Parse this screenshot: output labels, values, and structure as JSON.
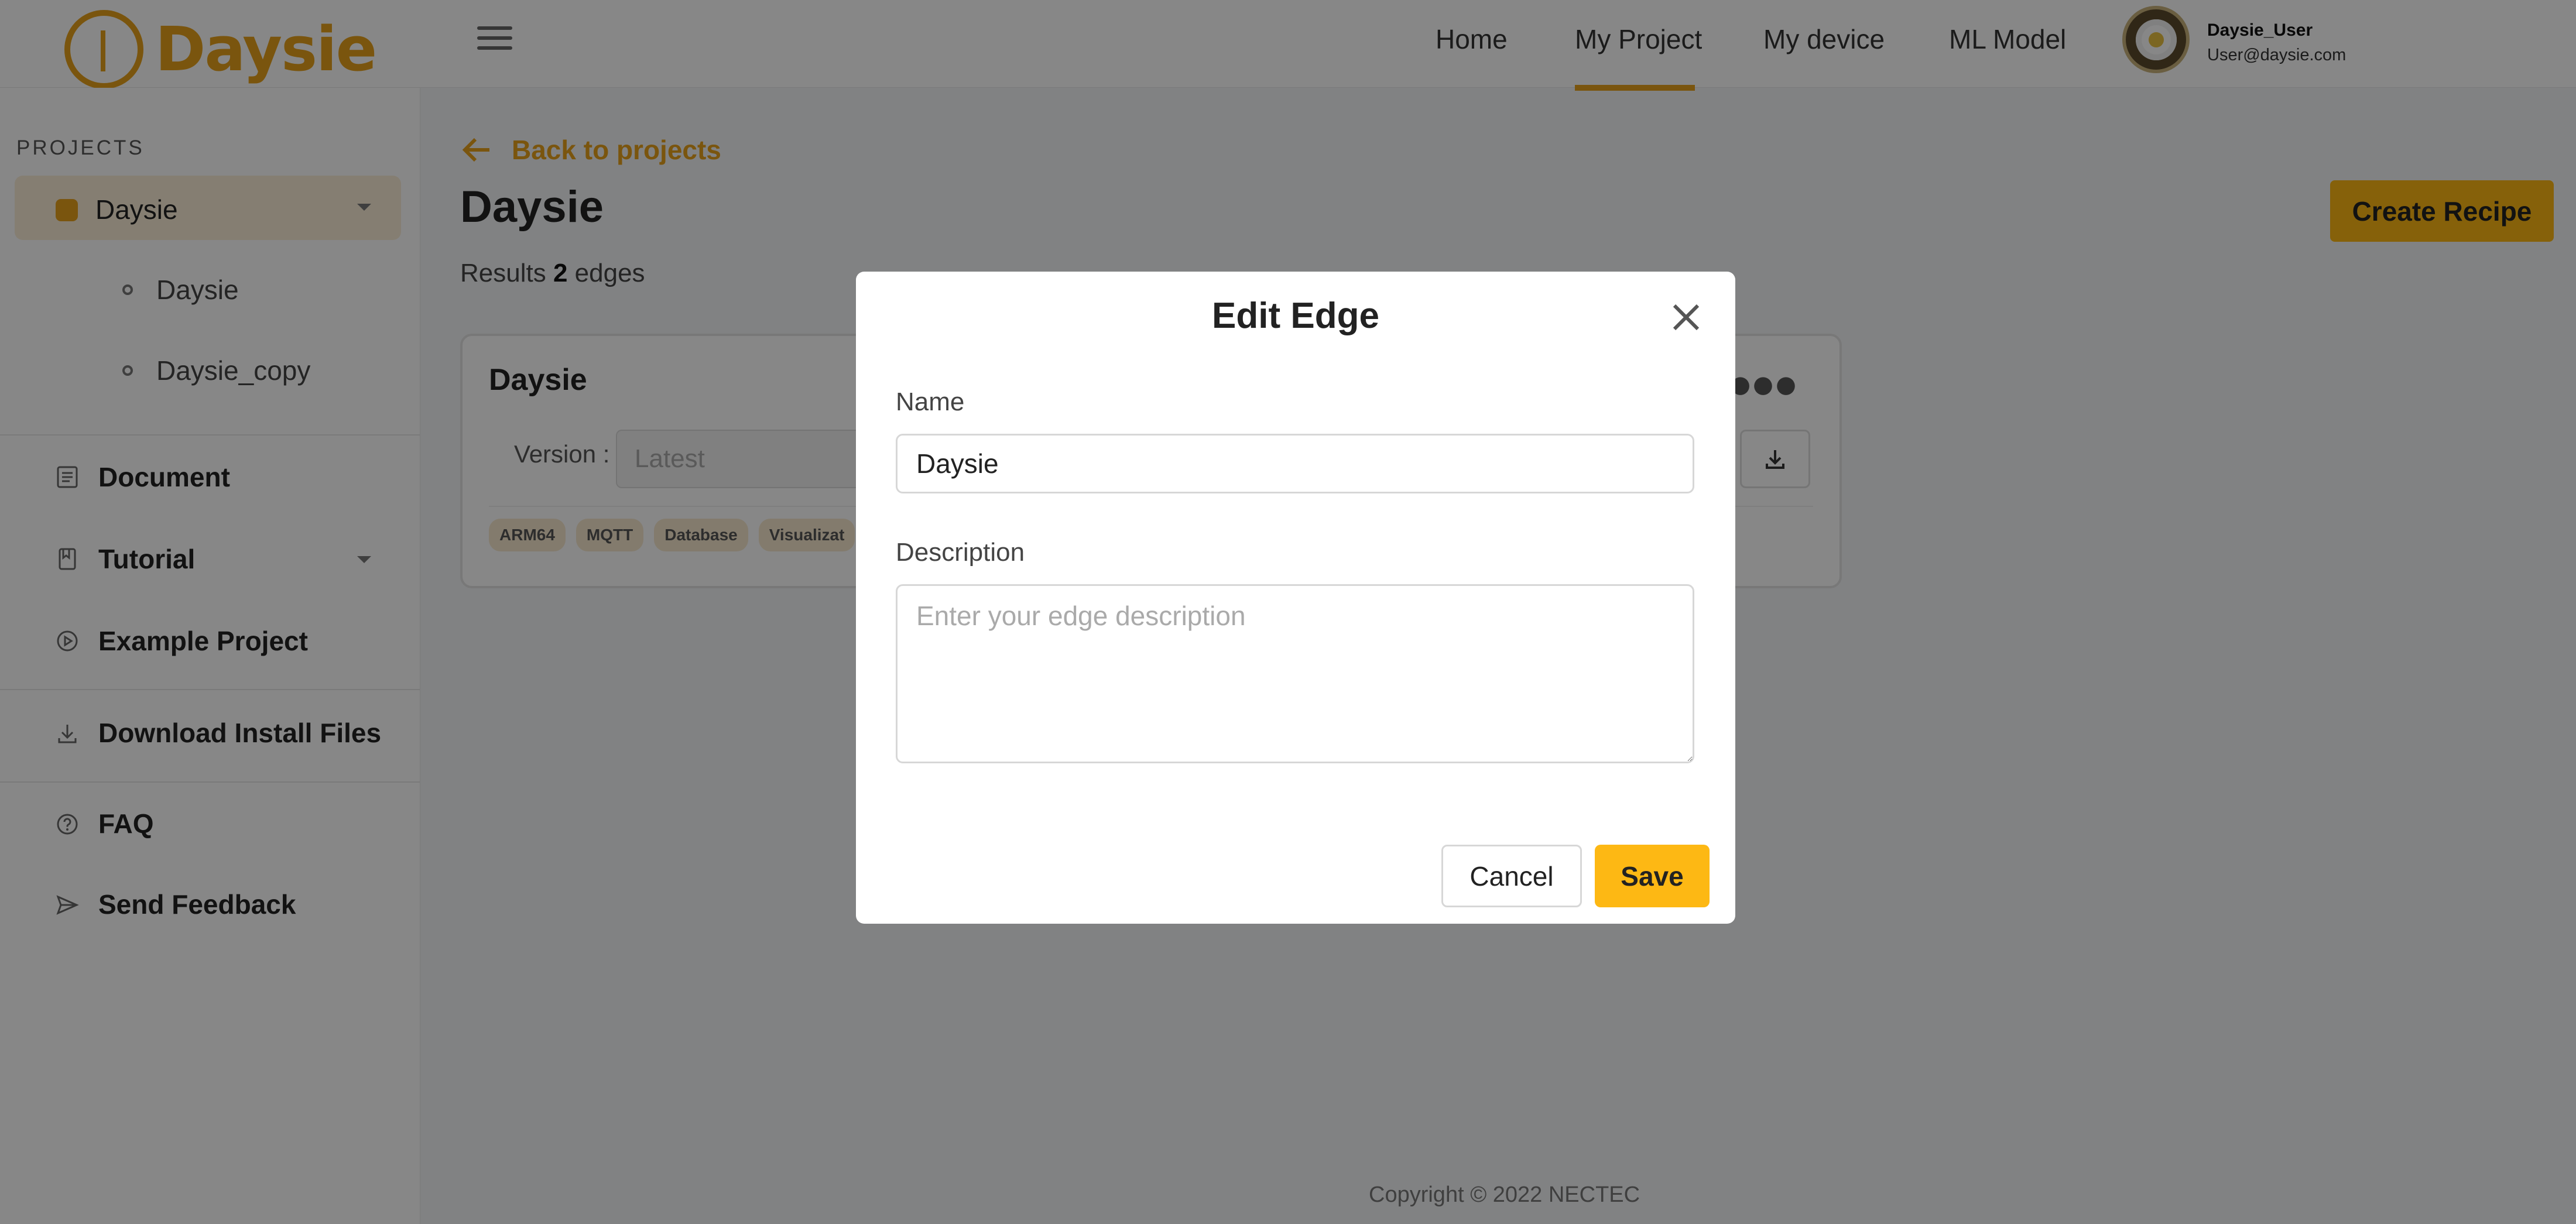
{
  "brand": {
    "name": "Daysie",
    "accent": "#e6a11c",
    "button": "#fdb814"
  },
  "nav": {
    "items": [
      "Home",
      "My Project",
      "My device",
      "ML Model"
    ],
    "active": "My Project"
  },
  "user": {
    "name": "Daysie_User",
    "email": "User@daysie.com"
  },
  "sidebar": {
    "heading": "PROJECTS",
    "project": "Daysie",
    "sub_items": [
      "Daysie",
      "Daysie_copy"
    ],
    "items": {
      "document": "Document",
      "tutorial": "Tutorial",
      "example": "Example Project",
      "download": "Download Install Files",
      "faq": "FAQ",
      "feedback": "Send Feedback"
    }
  },
  "main": {
    "back_label": "Back to projects",
    "title": "Daysie",
    "results_prefix": "Results",
    "results_count": "2",
    "results_suffix": "edges",
    "create_button": "Create Recipe",
    "card": {
      "name": "Daysie",
      "version_label": "Version :",
      "version_placeholder": "Latest",
      "tags": [
        "ARM64",
        "MQTT",
        "Database",
        "Visualizat"
      ]
    }
  },
  "footer": {
    "copyright": "Copyright © 2022 NECTEC"
  },
  "modal": {
    "title": "Edit Edge",
    "name_label": "Name",
    "name_value": "Daysie",
    "description_label": "Description",
    "description_placeholder": "Enter your edge description",
    "cancel_label": "Cancel",
    "save_label": "Save"
  }
}
